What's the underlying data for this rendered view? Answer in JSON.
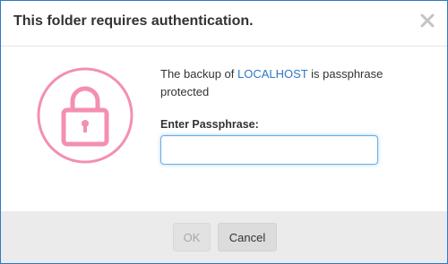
{
  "dialog": {
    "title": "This folder requires authentication.",
    "close_icon": "close-icon",
    "lock_icon": "lock-icon"
  },
  "message": {
    "prefix": "The backup of ",
    "host": "LOCALHOST",
    "suffix": " is passphrase protected"
  },
  "passphrase": {
    "label": "Enter Passphrase:",
    "value": "",
    "placeholder": ""
  },
  "buttons": {
    "ok_label": "OK",
    "ok_disabled": true,
    "cancel_label": "Cancel"
  },
  "colors": {
    "accent": "#2f78c4",
    "lock": "#f48fb1",
    "footer": "#ebebeb"
  }
}
